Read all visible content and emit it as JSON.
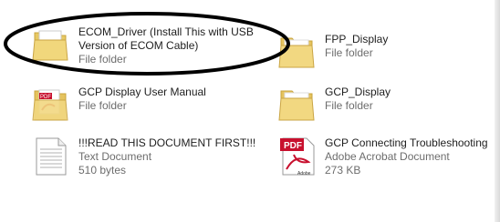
{
  "items": [
    {
      "name": "ECOM_Driver (Install This with USB Version of ECOM Cable)",
      "type": "File folder",
      "icon": "folder-ecom-icon"
    },
    {
      "name": "FPP_Display",
      "type": "File folder",
      "icon": "folder-icon"
    },
    {
      "name": "GCP Display User Manual",
      "type": "File folder",
      "icon": "folder-pdf-icon"
    },
    {
      "name": "GCP_Display",
      "type": "File folder",
      "icon": "folder-icon"
    },
    {
      "name": "!!!READ THIS DOCUMENT FIRST!!!",
      "type": "Text Document",
      "size": "510 bytes",
      "icon": "text-document-icon"
    },
    {
      "name": "GCP Connecting Troubleshooting",
      "type": "Adobe Acrobat Document",
      "size": "273 KB",
      "icon": "pdf-document-icon"
    }
  ],
  "annotation": {
    "shape": "ellipse",
    "color": "#000000"
  }
}
